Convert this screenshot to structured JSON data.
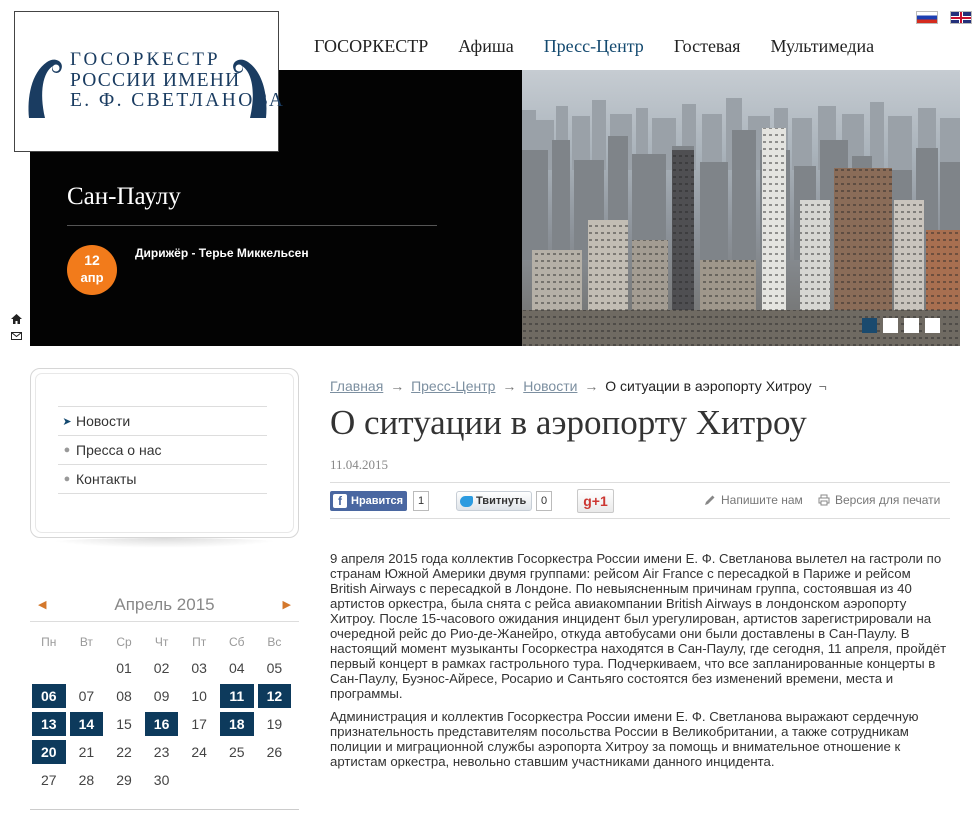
{
  "logo": {
    "line1": "ГОСОРКЕСТР",
    "line2": "РОССИИ ИМЕНИ",
    "line3": "Е. Ф. СВЕТЛАНОВА"
  },
  "nav": [
    {
      "label": "ГОСОРКЕСТР",
      "active": false
    },
    {
      "label": "Афиша",
      "active": false
    },
    {
      "label": "Пресс-Центр",
      "active": true
    },
    {
      "label": "Гостевая",
      "active": false
    },
    {
      "label": "Мультимедиа",
      "active": false
    }
  ],
  "flags": [
    "russia-flag-icon",
    "uk-flag-icon"
  ],
  "banner": {
    "city": "Сан-Паулу",
    "date_day": "12",
    "date_month": "апр",
    "conductor": "Дирижёр - Терье Миккельсен",
    "slides": 4,
    "active_slide": 0
  },
  "side_icons": [
    "home-icon",
    "mail-icon"
  ],
  "sidemenu": {
    "items": [
      {
        "label": "Новости",
        "active": true
      },
      {
        "label": "Пресса о нас",
        "active": false
      },
      {
        "label": "Контакты",
        "active": false
      }
    ]
  },
  "calendar": {
    "month": "Апрель 2015",
    "weekdays": [
      "Пн",
      "Вт",
      "Ср",
      "Чт",
      "Пт",
      "Сб",
      "Вс"
    ],
    "leading_blanks": 2,
    "days": [
      "01",
      "02",
      "03",
      "04",
      "05",
      "06",
      "07",
      "08",
      "09",
      "10",
      "11",
      "12",
      "13",
      "14",
      "15",
      "16",
      "17",
      "18",
      "19",
      "20",
      "21",
      "22",
      "23",
      "24",
      "25",
      "26",
      "27",
      "28",
      "29",
      "30"
    ],
    "event_days": [
      "06",
      "11",
      "12",
      "13",
      "14",
      "16",
      "18",
      "20"
    ]
  },
  "breadcrumb": {
    "items": [
      "Главная",
      "Пресс-Центр",
      "Новости"
    ],
    "current": "О ситуации в аэропорту Хитроу",
    "separator": "→",
    "tail": "¬"
  },
  "article": {
    "title": "О ситуации в аэропорту Хитроу",
    "date": "11.04.2015",
    "paragraphs": [
      "9 апреля 2015 года коллектив Госоркестра России имени Е. Ф. Светланова вылетел на гастроли по странам Южной Америки двумя группами: рейсом Air France с пересадкой в Париже и рейсом British Airways с пересадкой в Лондоне. По невыясненным причинам группа, состоявшая из 40 артистов оркестра, была снята с рейса авиакомпании British Airways в лондонском аэропорту Хитроу. После 15-часового ожидания инцидент был урегулирован, артистов зарегистрировали на очередной рейс до Рио-де-Жанейро, откуда автобусами они были доставлены в Сан-Паулу. В настоящий момент музыканты Госоркестра находятся в Сан-Паулу, где сегодня, 11 апреля, пройдёт первый концерт в рамках гастрольного тура. Подчеркиваем, что все запланированные концерты в Сан-Паулу, Буэнос-Айресе, Росарио и Сантьяго состоятся без изменений времени, места и программы.",
      "Администрация и коллектив Госоркестра России имени Е. Ф. Светланова выражают сердечную признательность представителям посольства России в Великобритании, а также сотрудникам полиции и миграционной службы аэропорта Хитроу за помощь и внимательное отношение к артистам оркестра, невольно ставшим участниками данного инцидента."
    ]
  },
  "share": {
    "fb_label": "Нравится",
    "fb_count": "1",
    "tw_label": "Твитнуть",
    "tw_count": "0",
    "gp_label": "g+1",
    "write_label": "Напишите нам",
    "print_label": "Версия для печати"
  },
  "colors": {
    "brand": "#1a3c61",
    "accent": "#f27b1b",
    "calendar_event": "#0d3a5c"
  }
}
